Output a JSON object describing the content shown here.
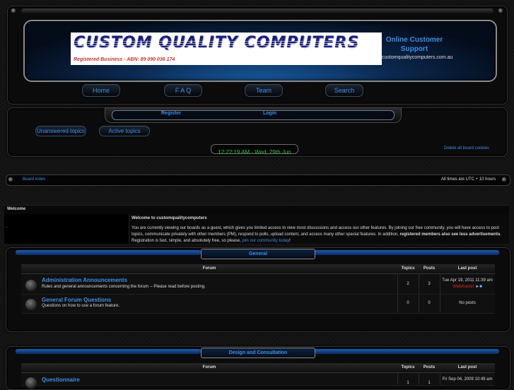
{
  "header": {
    "logo_title": "CUSTOM QUALITY COMPUTERS",
    "logo_subtitle": "Registered Business - ABN: 89 090 036 174",
    "online_line1": "Online Customer",
    "online_line2": "Support",
    "domain": "customqualitycomputers.com.au"
  },
  "nav": {
    "home": "Home",
    "faq": "F A Q",
    "team": "Team",
    "search": "Search"
  },
  "auth": {
    "register": "Register",
    "login": "Login"
  },
  "quick_links": {
    "unanswered": "Unanswered topics",
    "active": "Active topics"
  },
  "clock": "12:22:19 AM - Wed, 29th Jun",
  "delete_cookies": "Delete all board cookies",
  "breadcrumb": {
    "board_index": "Board index",
    "timezone": "All times are UTC + 10 hours"
  },
  "welcome": {
    "strip_label": "Welcome",
    "dot": ".",
    "heading": "Welcome to customqualitycomputers",
    "body_1": "You are currently viewing our boards as a guest, which gives you limited access to view most discussions and access our other features. By joining our free community, you will have access to post topics, communicate privately with other members (PM), respond to polls, upload content, and access many other special features. In addition, ",
    "body_bold": "registered members also see less advertisements",
    "body_2": ". Registration is fast, simple, and absolutely free, so please, ",
    "join_link": "join our community today",
    "body_end": "!"
  },
  "table_headers": {
    "forum": "Forum",
    "topics": "Topics",
    "posts": "Posts",
    "last_post": "Last post"
  },
  "sections": [
    {
      "title": "General",
      "forums": [
        {
          "title": "Administration Announcements",
          "desc": "Rules and general announcements concerning the forum -- Please read before posting.",
          "topics": "2",
          "posts": "3",
          "last_date": "Tue Apr 19, 2011 11:39 am",
          "last_user": "Webmaster"
        },
        {
          "title": "General Forum Questions",
          "desc": "Questions on how to use a forum feature.",
          "topics": "0",
          "posts": "0",
          "last_date": "No posts",
          "last_user": ""
        }
      ]
    },
    {
      "title": "Design and Consultation",
      "forums": [
        {
          "title": "Questionnaire",
          "desc": "",
          "topics": "1",
          "posts": "1",
          "last_date": "Fri Sep 04, 2009 10:49 am",
          "last_user": ""
        }
      ]
    }
  ],
  "colors": {
    "accent": "#3f8fe8",
    "user_red": "#d62b2b",
    "clock_green": "#35c24a"
  }
}
